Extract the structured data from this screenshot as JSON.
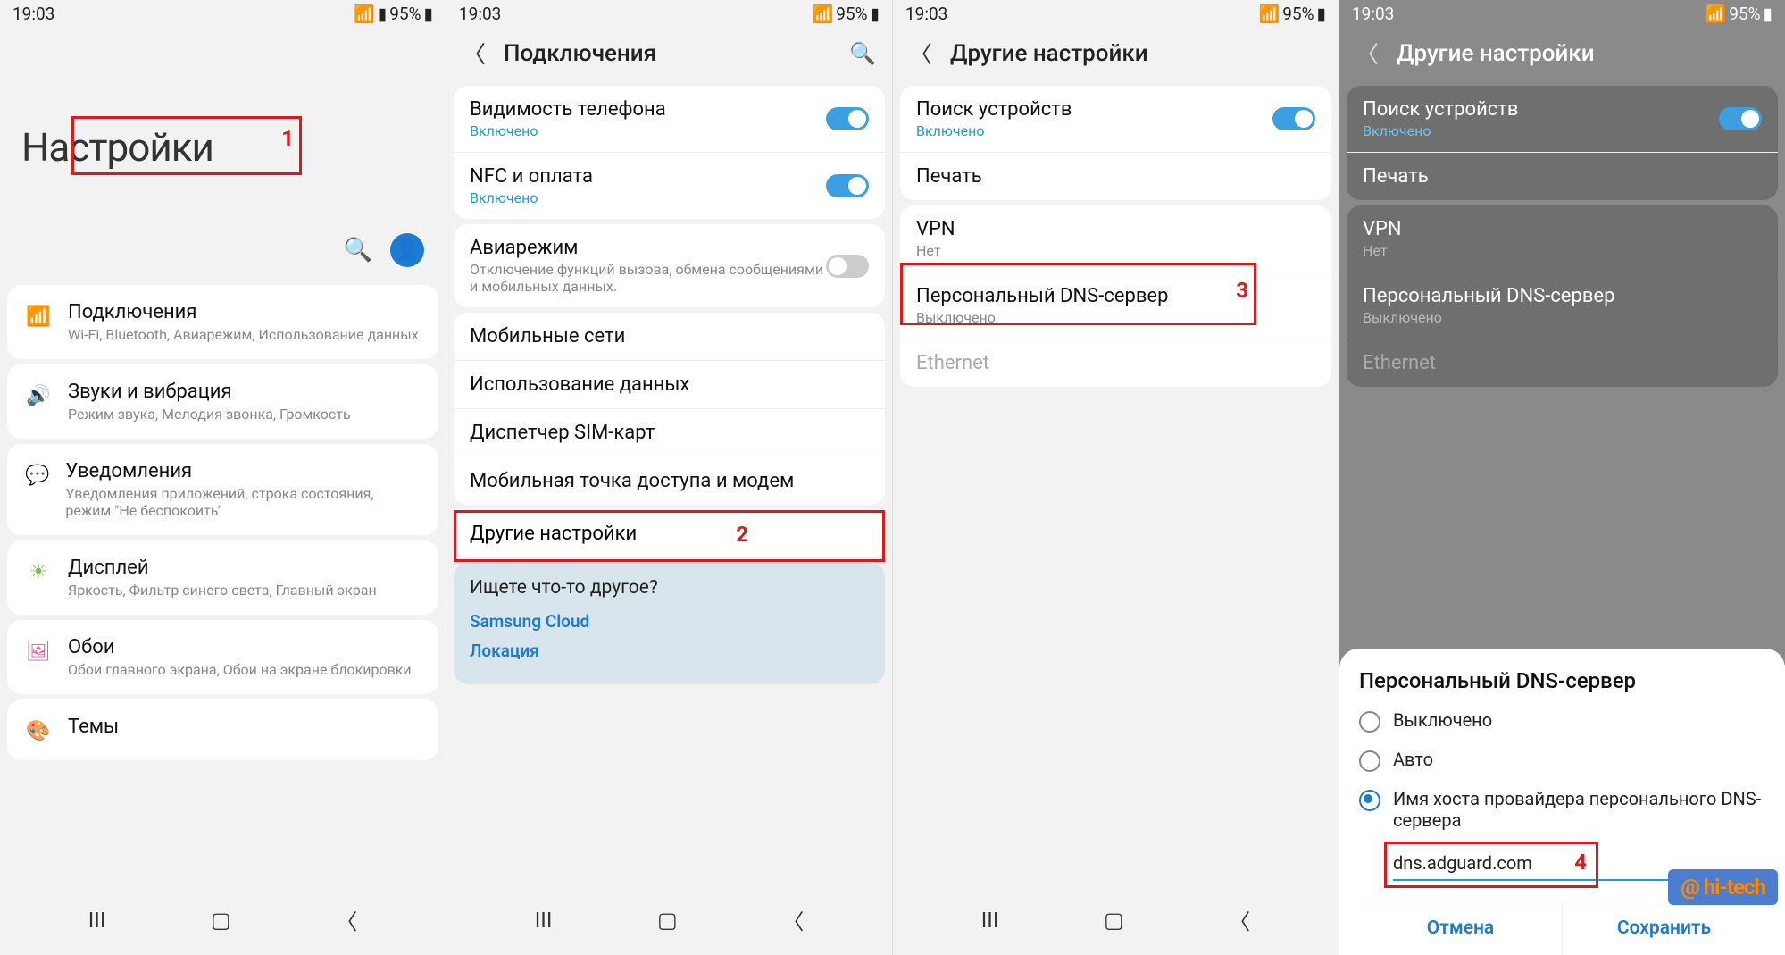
{
  "status": {
    "time": "19:03",
    "battery": "95%"
  },
  "p1": {
    "title": "Настройки",
    "items": [
      {
        "t": "Подключения",
        "s": "Wi-Fi, Bluetooth, Авиарежим, Использование данных",
        "icon": "📶",
        "c": "#1e8dd6"
      },
      {
        "t": "Звуки и вибрация",
        "s": "Режим звука, Мелодия звонка, Громкость",
        "icon": "🔊",
        "c": "#b26bd1"
      },
      {
        "t": "Уведомления",
        "s": "Уведомления приложений, строка состояния, режим \"Не беспокоить\"",
        "icon": "💬",
        "c": "#e06262"
      },
      {
        "t": "Дисплей",
        "s": "Яркость, Фильтр синего света, Главный экран",
        "icon": "☀",
        "c": "#7bc24a"
      },
      {
        "t": "Обои",
        "s": "Обои главного экрана, Обои на экране блокировки",
        "icon": "🖼",
        "c": "#d65b9e"
      },
      {
        "t": "Темы",
        "s": "",
        "icon": "🎨",
        "c": "#888"
      }
    ]
  },
  "p2": {
    "title": "Подключения",
    "g1": [
      {
        "t": "Видимость телефона",
        "s": "Включено",
        "tog": true
      },
      {
        "t": "NFC и оплата",
        "s": "Включено",
        "tog": true
      }
    ],
    "air": {
      "t": "Авиарежим",
      "s": "Отключение функций вызова, обмена сообщениями и мобильных данных.",
      "tog": false
    },
    "g2": [
      "Мобильные сети",
      "Использование данных",
      "Диспетчер SIM-карт",
      "Мобильная точка доступа и модем"
    ],
    "more": "Другие настройки",
    "suggest": {
      "q": "Ищете что-то другое?",
      "links": [
        "Samsung Cloud",
        "Локация"
      ]
    }
  },
  "p3": {
    "title": "Другие настройки",
    "g1": [
      {
        "t": "Поиск устройств",
        "s": "Включено",
        "tog": true
      },
      {
        "t": "Печать"
      }
    ],
    "g2": [
      {
        "t": "VPN",
        "s": "Нет"
      },
      {
        "t": "Персональный DNS-сервер",
        "s": "Выключено"
      },
      {
        "t": "Ethernet",
        "dis": true
      }
    ]
  },
  "p4": {
    "title": "Другие настройки",
    "dialog": {
      "title": "Персональный DNS-сервер",
      "opts": [
        "Выключено",
        "Авто",
        "Имя хоста провайдера персонального DNS-сервера"
      ],
      "value": "dns.adguard.com",
      "cancel": "Отмена",
      "save": "Сохранить"
    }
  },
  "wm": "@ hi-tech"
}
